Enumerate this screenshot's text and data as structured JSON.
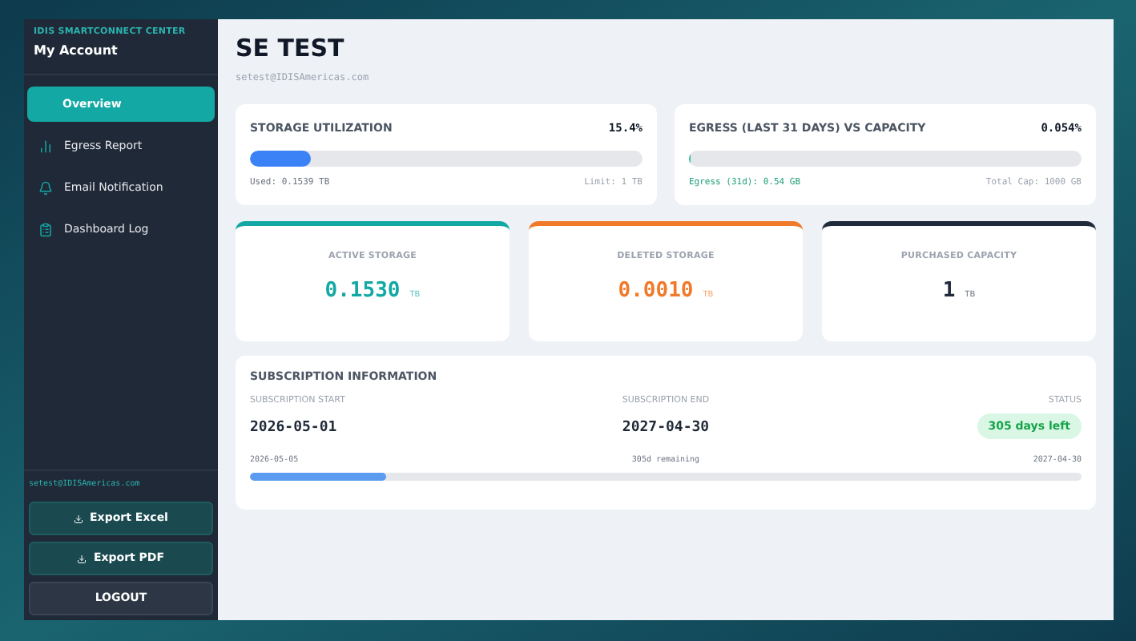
{
  "sidebar": {
    "brand": "IDIS SMARTCONNECT CENTER",
    "account": "My Account",
    "items": [
      {
        "label": "Overview",
        "kind": "plain",
        "selected": true
      },
      {
        "label": "Egress Report",
        "kind": "chart",
        "selected": false
      },
      {
        "label": "Email Notification",
        "kind": "bell",
        "selected": false
      },
      {
        "label": "Dashboard Log",
        "kind": "clipboard",
        "selected": false
      }
    ],
    "email": "setest@IDISAmericas.com",
    "buttons": [
      {
        "label": "Export Excel",
        "kind": "export"
      },
      {
        "label": "Export PDF",
        "kind": "export"
      },
      {
        "label": "LOGOUT",
        "kind": "logout"
      }
    ]
  },
  "header": {
    "title": "SE TEST",
    "email": "setest@IDISAmericas.com"
  },
  "usage": [
    {
      "title": "STORAGE UTILIZATION",
      "percent": "15.4%",
      "level": 0.154,
      "color": "#3b82f6",
      "left": "Used: 0.1539 TB",
      "right": "Limit: 1 TB",
      "kind": "storage"
    },
    {
      "title": "EGRESS (LAST 31 DAYS) VS CAPACITY",
      "percent": "0.054%",
      "level": 0.00054,
      "color": "#2bbf9a",
      "left": "Egress (31d): 0.54 GB",
      "right": "Total Cap: 1000 GB",
      "kind": "egress"
    }
  ],
  "stats": [
    {
      "label": "ACTIVE STORAGE",
      "value": "0.1530",
      "unit": "TB",
      "color": "#14a8a4"
    },
    {
      "label": "DELETED STORAGE",
      "value": "0.0010",
      "unit": "TB",
      "color": "#f07a2a"
    },
    {
      "label": "PURCHASED CAPACITY",
      "value": "1",
      "unit": "TB",
      "color": "#1f2a3a"
    }
  ],
  "subscription": {
    "title": "SUBSCRIPTION INFORMATION",
    "start_label": "SUBSCRIPTION START",
    "start": "2026-05-01",
    "end_label": "SUBSCRIPTION END",
    "end": "2027-04-30",
    "status_label": "STATUS",
    "status": "305 days left",
    "bar_start": "2026-05-05",
    "bar_middle": "305d remaining",
    "bar_end": "2027-04-30",
    "level": 0.164
  }
}
